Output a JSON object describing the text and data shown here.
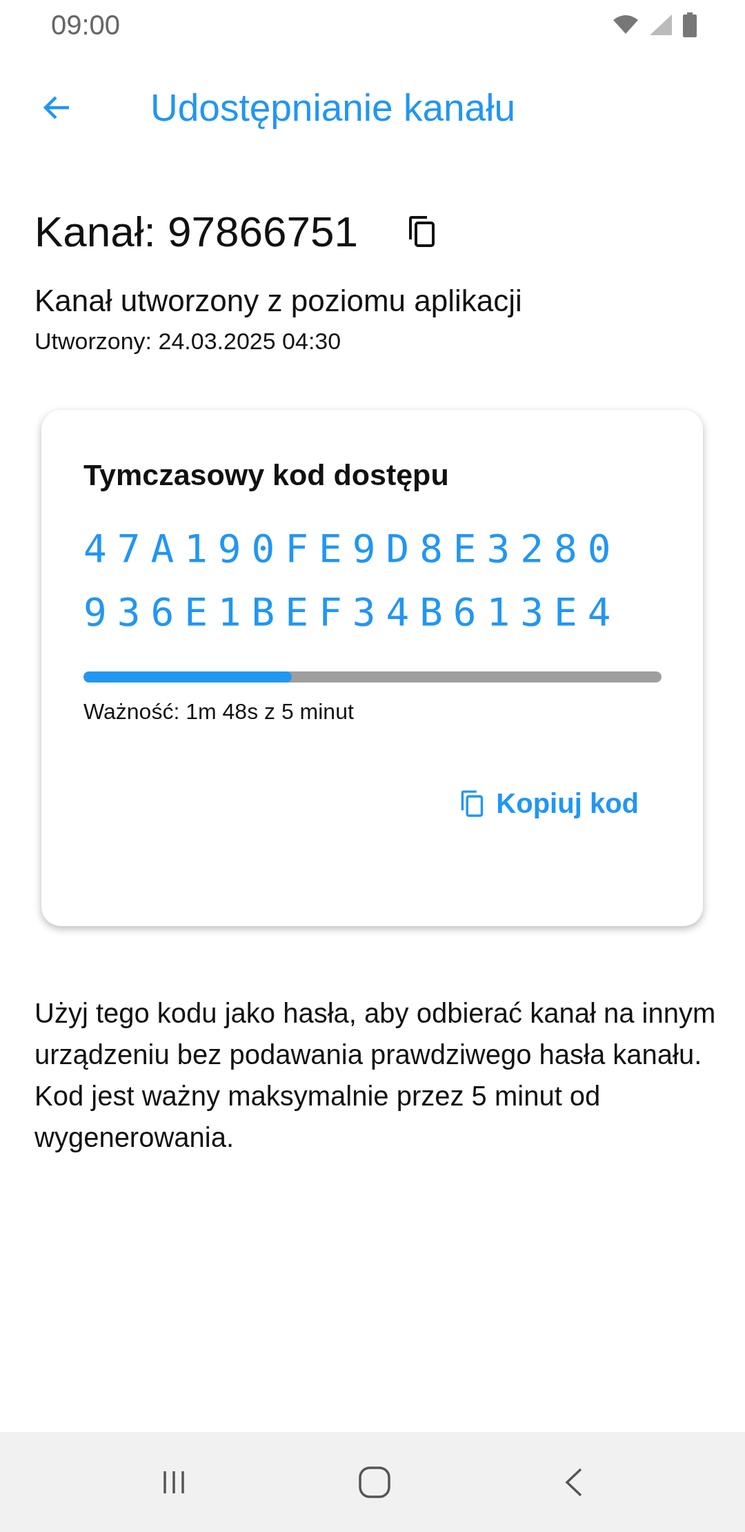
{
  "status_bar": {
    "time": "09:00"
  },
  "app_bar": {
    "title": "Udostępnianie kanału"
  },
  "channel": {
    "title": "Kanał: 97866751",
    "subtitle": "Kanał utworzony z poziomu aplikacji",
    "created": "Utworzony: 24.03.2025 04:30"
  },
  "code_card": {
    "title": "Tymczasowy kod dostępu",
    "code": "47A190FE9D8E3280936E1BEF34B613E4",
    "level": 0.36,
    "validity": "Ważność: 1m 48s z 5 minut",
    "copy_button": "Kopiuj kod"
  },
  "info": "Użyj tego kodu jako hasła, aby odbierać kanał na innym urządzeniu bez podawania prawdziwego hasła kanału. Kod jest ważny maksymalnie przez 5 minut od wygenerowania."
}
